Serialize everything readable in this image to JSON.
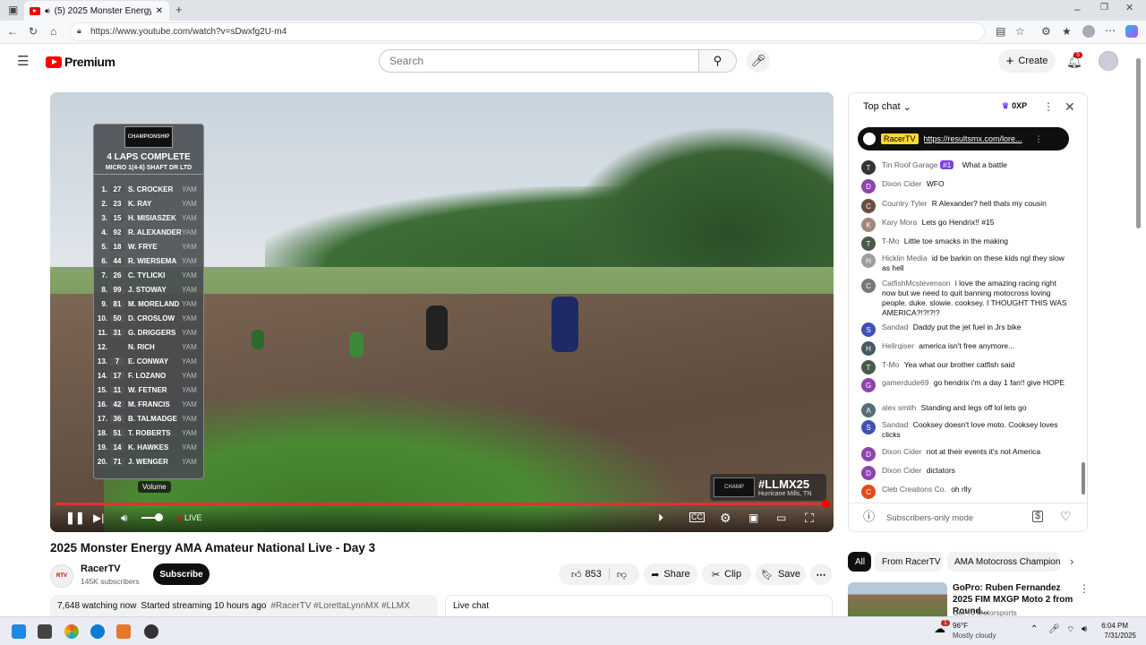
{
  "browser": {
    "tab_title": "(5) 2025 Monster Energy AMA",
    "url": "https://www.youtube.com/watch?v=sDwxfg2U-m4"
  },
  "header": {
    "logo": "Premium",
    "search_placeholder": "Search",
    "create": "Create",
    "notif_count": "5"
  },
  "player": {
    "banner": "CHAMPIONSHIP",
    "laps": "4 LAPS COMPLETE",
    "class_name": "MICRO 1(4-6) SHAFT DR LTD",
    "leaderboard": [
      {
        "p": "1.",
        "n": "27",
        "name": "S. CROCKER",
        "m": "YAM"
      },
      {
        "p": "2.",
        "n": "23",
        "name": "K. RAY",
        "m": "YAM"
      },
      {
        "p": "3.",
        "n": "15",
        "name": "H. MISIASZEK",
        "m": "YAM"
      },
      {
        "p": "4.",
        "n": "92",
        "name": "R. ALEXANDER",
        "m": "YAM"
      },
      {
        "p": "5.",
        "n": "18",
        "name": "W. FRYE",
        "m": "YAM"
      },
      {
        "p": "6.",
        "n": "44",
        "name": "R. WIERSEMA",
        "m": "YAM"
      },
      {
        "p": "7.",
        "n": "26",
        "name": "C. TYLICKI",
        "m": "YAM"
      },
      {
        "p": "8.",
        "n": "99",
        "name": "J. STOWAY",
        "m": "YAM"
      },
      {
        "p": "9.",
        "n": "81",
        "name": "M. MORELAND",
        "m": "YAM"
      },
      {
        "p": "10.",
        "n": "50",
        "name": "D. CROSLOW",
        "m": "YAM"
      },
      {
        "p": "11.",
        "n": "31",
        "name": "G. DRIGGERS",
        "m": "YAM"
      },
      {
        "p": "12.",
        "n": "",
        "name": "N. RICH",
        "m": "YAM"
      },
      {
        "p": "13.",
        "n": "7",
        "name": "E. CONWAY",
        "m": "YAM"
      },
      {
        "p": "14.",
        "n": "17",
        "name": "F. LOZANO",
        "m": "YAM"
      },
      {
        "p": "15.",
        "n": "11",
        "name": "W. FETNER",
        "m": "YAM"
      },
      {
        "p": "16.",
        "n": "42",
        "name": "M. FRANCIS",
        "m": "YAM"
      },
      {
        "p": "17.",
        "n": "36",
        "name": "B. TALMADGE",
        "m": "YAM"
      },
      {
        "p": "18.",
        "n": "51",
        "name": "T. ROBERTS",
        "m": "YAM"
      },
      {
        "p": "19.",
        "n": "14",
        "name": "K. HAWKES",
        "m": "YAM"
      },
      {
        "p": "20.",
        "n": "71",
        "name": "J. WENGER",
        "m": "YAM"
      }
    ],
    "hashtag": "#LLMX25",
    "location": "Hurricane Mills, TN",
    "tooltip": "Volume",
    "live": "LIVE"
  },
  "video": {
    "title": "2025 Monster Energy AMA Amateur National Live - Day 3",
    "channel": "RacerTV",
    "subs": "145K subscribers",
    "subscribe": "Subscribe",
    "likes": "853",
    "share": "Share",
    "clip": "Clip",
    "save": "Save",
    "watching": "7,648 watching now",
    "started": "Started streaming 10 hours ago",
    "tags": "#RacerTV #LorettaLynnMX #LLMX",
    "live_chat": "Live chat"
  },
  "chat": {
    "mode": "Top chat",
    "xp": "0XP",
    "pinned_user": "RacerTV",
    "pinned_link": "https://resultsmx.com/lore...",
    "footer": "Subscribers-only mode",
    "messages": [
      {
        "a": "Tin Roof Garage",
        "badge": "#1",
        "t": "What a battle",
        "c": "#333"
      },
      {
        "a": "Dixon Cider",
        "t": "WFO",
        "c": "#8e44ad"
      },
      {
        "a": "Country Tyler",
        "t": "R Alexander? hell thats my cousin",
        "c": "#6d4c41"
      },
      {
        "a": "Kary Mora",
        "t": "Lets go Hendrix!! #15",
        "c": "#a1887f"
      },
      {
        "a": "T-Mo",
        "t": "Little toe smacks in the making",
        "c": "#4a5a4a"
      },
      {
        "a": "Hicklin Media",
        "t": "id be barkin on these kids ngl they slow as hell",
        "c": "#9e9e9e"
      },
      {
        "a": "CatfishMcstevenson",
        "t": "i love the amazing racing right now but we need to quit banning motocross loving people. duke. slowie. cooksey. I THOUGHT THIS WAS AMERICA?!?!?!?",
        "c": "#777"
      },
      {
        "a": "Sandad",
        "t": "Daddy put the jet fuel in Jrs bike",
        "c": "#3f51b5"
      },
      {
        "a": "Hellrqiser",
        "t": "america isn't free anymore...",
        "c": "#455a64"
      },
      {
        "a": "T-Mo",
        "t": "Yea what our brother catfish said",
        "c": "#4a5a4a"
      },
      {
        "a": "gamerdude69",
        "t": "go hendrix i'm a day 1 fan!! give HOPE",
        "c": "#8e44ad"
      },
      {
        "a": "alex smith",
        "t": "Standing and legs off lol lets go",
        "c": "#546e7a"
      },
      {
        "a": "Sandad",
        "t": "Cooksey doesn't love moto. Cooksey loves clicks",
        "c": "#3f51b5"
      },
      {
        "a": "Dixon Cider",
        "t": "not at their events it's not America",
        "c": "#8e44ad"
      },
      {
        "a": "Dixon Cider",
        "t": "dictators",
        "c": "#8e44ad"
      },
      {
        "a": "Cleb Creations Co.",
        "t": "oh rlly",
        "c": "#e64a19"
      }
    ]
  },
  "chips": [
    "All",
    "From RacerTV",
    "AMA Motocross Champion"
  ],
  "rec": {
    "title": "GoPro: Ruben Fernandez 2025 FIM MXGP Moto 2 from Round...",
    "channel": "GoPro Motorsports"
  },
  "taskbar": {
    "temp": "96°F",
    "weather": "Mostly cloudy",
    "time": "6:04 PM",
    "date": "7/31/2025",
    "weather_badge": "1"
  }
}
